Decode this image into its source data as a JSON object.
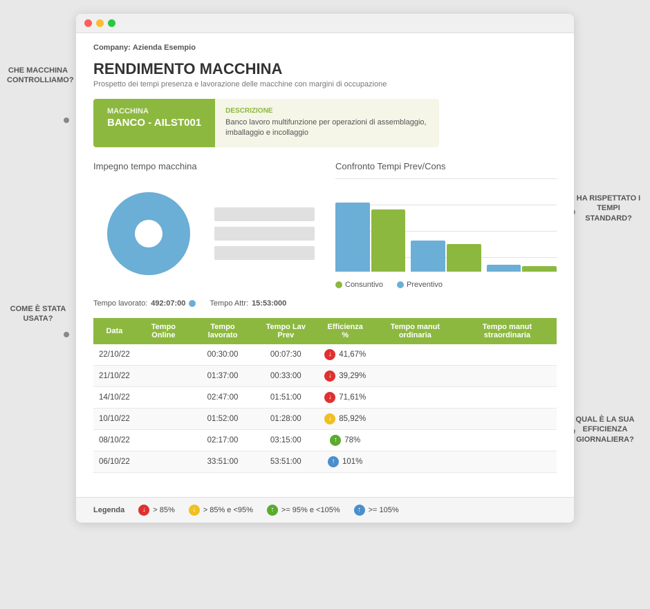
{
  "window": {
    "company_label": "Company:",
    "company_name": "Azienda Esempio"
  },
  "header": {
    "title": "RENDIMENTO MACCHINA",
    "subtitle": "Prospetto dei tempi presenza e lavorazione delle macchine con margini di occupazione"
  },
  "machine": {
    "label": "Macchina",
    "id": "BANCO - AILST001",
    "desc_label": "DESCRIZIONE",
    "desc_text": "Banco lavoro multifunzione per operazioni di assemblaggio, imballaggio e incollaggio"
  },
  "chart_left": {
    "title": "Impegno tempo macchina",
    "tempo_lavorato_label": "Tempo lavorato:",
    "tempo_lavorato_value": "492:07:00",
    "tempo_attr_label": "Tempo Attr:",
    "tempo_attr_value": "15:53:000"
  },
  "chart_right": {
    "title": "Confronto Tempi Prev/Cons",
    "legend_consuntivo": "Consuntivo",
    "legend_preventivo": "Preventivo"
  },
  "annotations": {
    "left1": "CHE MACCHINA CONTROLLIAMO?",
    "left2": "COME È STATA USATA?",
    "right1": "HA RISPETTATO I TEMPI STANDARD?",
    "right2": "QUAL È LA SUA EFFICIENZA GIORNALIERA?"
  },
  "table": {
    "headers": [
      "Data",
      "Tempo Online",
      "Tempo lavorato",
      "Tempo Lav Prev",
      "Efficienza %",
      "Tempo manut ordinaria",
      "Tempo manut straordinaria"
    ],
    "rows": [
      {
        "data": "22/10/22",
        "tempo_online": "",
        "tempo_lavorato": "00:30:00",
        "tempo_lav_prev": "00:07:30",
        "eff_icon": "red",
        "efficienza": "41,67%",
        "manut_ord": "",
        "manut_str": ""
      },
      {
        "data": "21/10/22",
        "tempo_online": "",
        "tempo_lavorato": "01:37:00",
        "tempo_lav_prev": "00:33:00",
        "eff_icon": "red",
        "efficienza": "39,29%",
        "manut_ord": "",
        "manut_str": ""
      },
      {
        "data": "14/10/22",
        "tempo_online": "",
        "tempo_lavorato": "02:47:00",
        "tempo_lav_prev": "01:51:00",
        "eff_icon": "red",
        "efficienza": "71,61%",
        "manut_ord": "",
        "manut_str": ""
      },
      {
        "data": "10/10/22",
        "tempo_online": "",
        "tempo_lavorato": "01:52:00",
        "tempo_lav_prev": "01:28:00",
        "eff_icon": "yellow",
        "efficienza": "85,92%",
        "manut_ord": "",
        "manut_str": ""
      },
      {
        "data": "08/10/22",
        "tempo_online": "",
        "tempo_lavorato": "02:17:00",
        "tempo_lav_prev": "03:15:00",
        "eff_icon": "green",
        "efficienza": "78%",
        "manut_ord": "",
        "manut_str": ""
      },
      {
        "data": "06/10/22",
        "tempo_online": "",
        "tempo_lavorato": "33:51:00",
        "tempo_lav_prev": "53:51:00",
        "eff_icon": "blue",
        "efficienza": "101%",
        "manut_ord": "",
        "manut_str": ""
      }
    ]
  },
  "legend": {
    "title": "Legenda",
    "items": [
      {
        "icon": "red",
        "text": "> 85%"
      },
      {
        "icon": "yellow",
        "text": "> 85% e <95%"
      },
      {
        "icon": "green",
        "text": ">= 95% e <105%"
      },
      {
        "icon": "blue",
        "text": ">= 105%"
      }
    ]
  }
}
